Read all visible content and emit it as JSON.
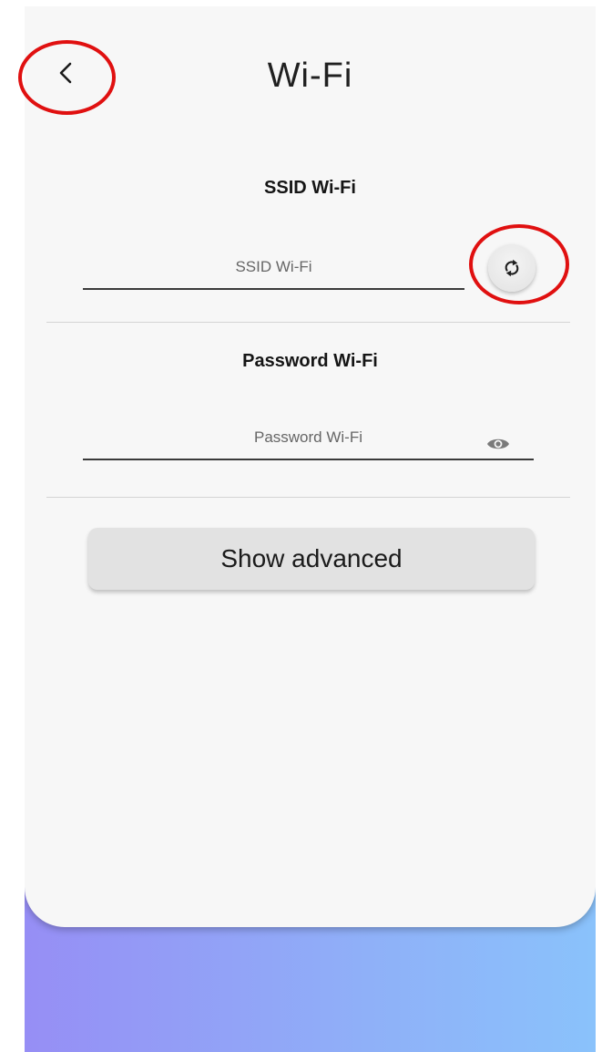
{
  "header": {
    "title": "Wi-Fi",
    "back_icon": "chevron-left-icon"
  },
  "ssid": {
    "label": "SSID Wi-Fi",
    "value": "",
    "placeholder": "SSID Wi-Fi",
    "refresh_icon": "refresh-icon"
  },
  "password": {
    "label": "Password Wi-Fi",
    "value": "",
    "placeholder": "Password Wi-Fi",
    "visibility_icon": "eye-icon"
  },
  "actions": {
    "show_advanced_label": "Show advanced"
  },
  "colors": {
    "card_background": "#f7f7f7",
    "gradient_start": "#968ef5",
    "gradient_end": "#8ac2fb",
    "annotation_ring": "#e01010",
    "button_background": "#e2e2e2"
  }
}
